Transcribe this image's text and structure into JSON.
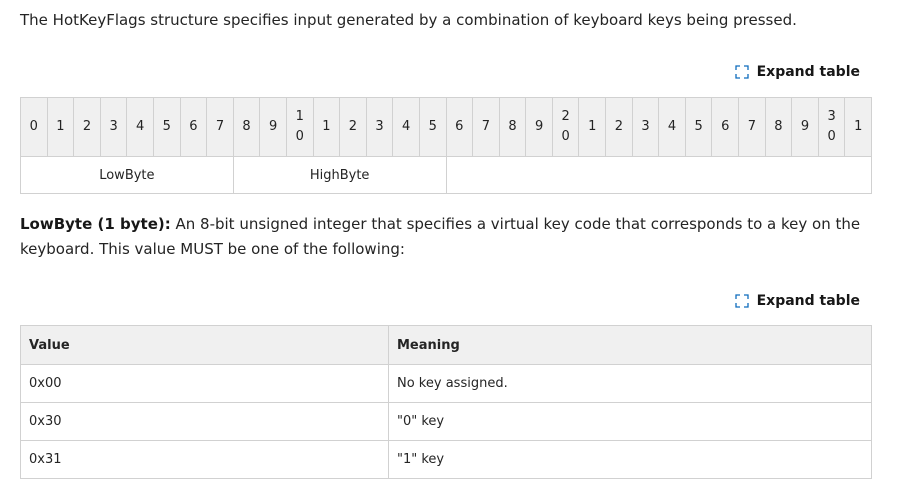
{
  "intro_text": "The HotKeyFlags structure specifies input generated by a combination of keyboard keys being pressed.",
  "expand_label": "Expand table",
  "bit_header": [
    {
      "top": "",
      "bottom": "0"
    },
    {
      "top": "",
      "bottom": "1"
    },
    {
      "top": "",
      "bottom": "2"
    },
    {
      "top": "",
      "bottom": "3"
    },
    {
      "top": "",
      "bottom": "4"
    },
    {
      "top": "",
      "bottom": "5"
    },
    {
      "top": "",
      "bottom": "6"
    },
    {
      "top": "",
      "bottom": "7"
    },
    {
      "top": "",
      "bottom": "8"
    },
    {
      "top": "",
      "bottom": "9"
    },
    {
      "top": "1",
      "bottom": "0"
    },
    {
      "top": "",
      "bottom": "1"
    },
    {
      "top": "",
      "bottom": "2"
    },
    {
      "top": "",
      "bottom": "3"
    },
    {
      "top": "",
      "bottom": "4"
    },
    {
      "top": "",
      "bottom": "5"
    },
    {
      "top": "",
      "bottom": "6"
    },
    {
      "top": "",
      "bottom": "7"
    },
    {
      "top": "",
      "bottom": "8"
    },
    {
      "top": "",
      "bottom": "9"
    },
    {
      "top": "2",
      "bottom": "0"
    },
    {
      "top": "",
      "bottom": "1"
    },
    {
      "top": "",
      "bottom": "2"
    },
    {
      "top": "",
      "bottom": "3"
    },
    {
      "top": "",
      "bottom": "4"
    },
    {
      "top": "",
      "bottom": "5"
    },
    {
      "top": "",
      "bottom": "6"
    },
    {
      "top": "",
      "bottom": "7"
    },
    {
      "top": "",
      "bottom": "8"
    },
    {
      "top": "",
      "bottom": "9"
    },
    {
      "top": "3",
      "bottom": "0"
    },
    {
      "top": "",
      "bottom": "1"
    }
  ],
  "bit_fields": [
    {
      "label": "LowByte",
      "bits": 8
    },
    {
      "label": "HighByte",
      "bits": 8
    },
    {
      "label": "",
      "bits": 16
    }
  ],
  "paragraph": {
    "field_name": "LowByte (1 byte):",
    "text": " An 8-bit unsigned integer that specifies a virtual key code that corresponds to a key on the keyboard. This value MUST be one of the following:"
  },
  "values_table": {
    "headers": [
      "Value",
      "Meaning"
    ],
    "rows": [
      [
        "0x00",
        "No key assigned."
      ],
      [
        "0x30",
        "\"0\" key"
      ],
      [
        "0x31",
        "\"1\" key"
      ]
    ]
  }
}
